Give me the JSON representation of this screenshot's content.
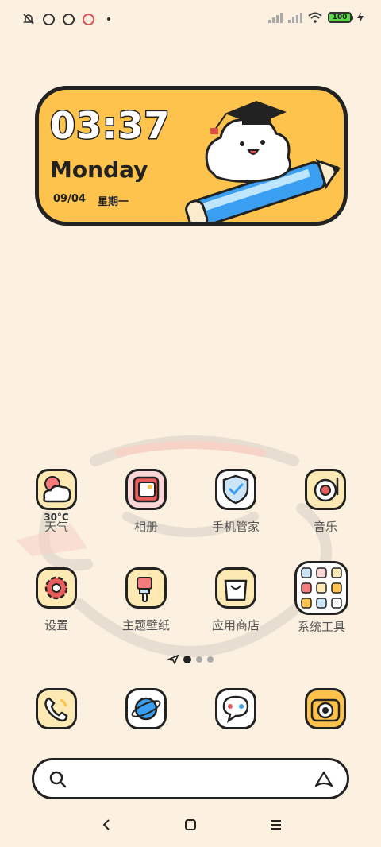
{
  "status_bar": {
    "battery_level": "100",
    "icons": [
      "bell-off-icon",
      "app-notification-icon",
      "app-notification-icon",
      "app-notification-icon",
      "dot-icon",
      "signal-icon",
      "signal-icon",
      "wifi-icon",
      "battery-icon",
      "charging-icon"
    ]
  },
  "clock_widget": {
    "time": "03:37",
    "day": "Monday",
    "date": "09/04",
    "weekday_cn": "星期一"
  },
  "apps_row1": [
    {
      "label": "天气",
      "sub": "30°C",
      "icon": "weather-icon"
    },
    {
      "label": "相册",
      "icon": "gallery-icon"
    },
    {
      "label": "手机管家",
      "icon": "security-icon"
    },
    {
      "label": "音乐",
      "icon": "music-icon"
    }
  ],
  "apps_row2": [
    {
      "label": "设置",
      "icon": "settings-icon"
    },
    {
      "label": "主题壁纸",
      "icon": "themes-icon"
    },
    {
      "label": "应用商店",
      "icon": "app-store-icon"
    },
    {
      "label": "系统工具",
      "icon": "folder-icon"
    }
  ],
  "dock": [
    {
      "icon": "phone-icon"
    },
    {
      "icon": "browser-icon"
    },
    {
      "icon": "messages-icon"
    },
    {
      "icon": "camera-icon"
    }
  ],
  "search_bar": {
    "search_icon": "search-icon",
    "assistant_icon": "assistant-icon"
  },
  "nav_bar": {
    "back": "back-icon",
    "home": "home-icon",
    "menu": "menu-icon"
  },
  "colors": {
    "background": "#fcf1e1",
    "widget": "#fdc34d",
    "outline": "#222222"
  }
}
